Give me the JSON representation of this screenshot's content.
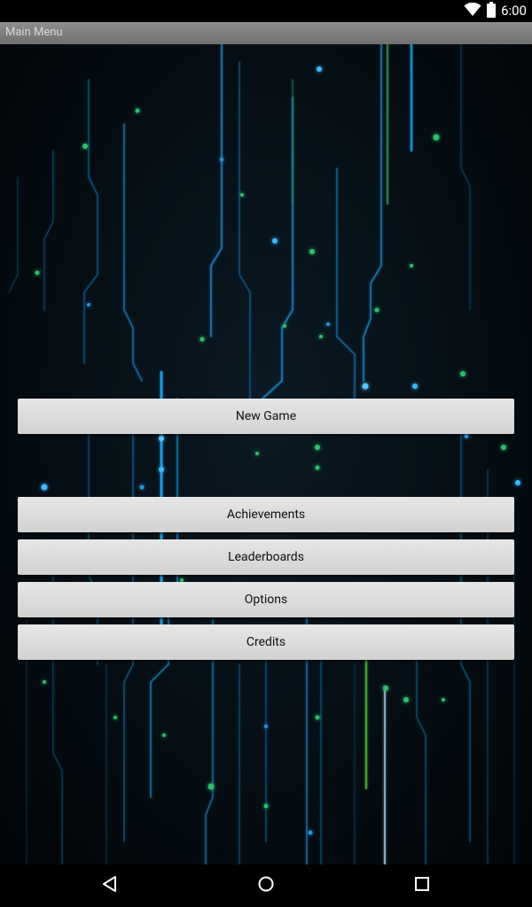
{
  "status_bar": {
    "time": "6:00",
    "icons": [
      "wifi-icon",
      "battery-icon"
    ]
  },
  "title_bar": {
    "title": "Main Menu"
  },
  "menu": {
    "new_game": "New Game",
    "achievements": "Achievements",
    "leaderboards": "Leaderboards",
    "options": "Options",
    "credits": "Credits"
  },
  "nav_bar": {
    "icons": [
      "back-icon",
      "home-icon",
      "recents-icon"
    ]
  },
  "colors": {
    "background": "#000000",
    "circuit_blue": "#1e8fd6",
    "circuit_green": "#2fbf6a",
    "button": "#dcdcdc",
    "title_bar": "#7f7f7f"
  }
}
